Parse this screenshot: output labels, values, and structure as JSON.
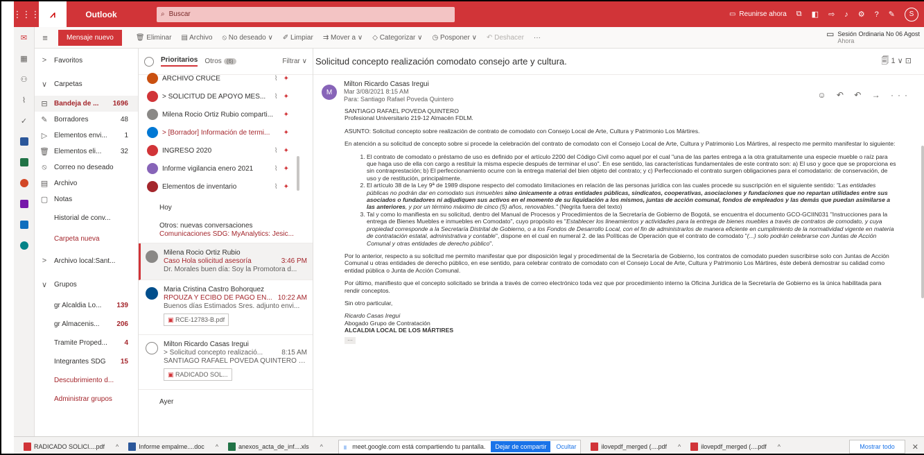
{
  "topbar": {
    "app_name": "Outlook",
    "search_placeholder": "Buscar",
    "meet_now": "Reunirse ahora",
    "avatar_initial": "S"
  },
  "command_bar": {
    "new_mail": "Mensaje nuevo",
    "delete": "Eliminar",
    "archive": "Archivo",
    "junk": "No deseado",
    "sweep": "Limpiar",
    "move_to": "Mover a",
    "categorize": "Categorizar",
    "snooze": "Posponer",
    "undo": "Deshacer",
    "more": "···",
    "meeting_title": "Sesión Ordinaria No 06 Agost",
    "meeting_time": "Ahora"
  },
  "folders": {
    "favorites": "Favoritos",
    "folders_header": "Carpetas",
    "items": [
      {
        "label": "Bandeja de ...",
        "count": "1696"
      },
      {
        "label": "Borradores",
        "count": "48"
      },
      {
        "label": "Elementos envi...",
        "count": "1"
      },
      {
        "label": "Elementos eli...",
        "count": "32"
      },
      {
        "label": "Correo no deseado",
        "count": ""
      },
      {
        "label": "Archivo",
        "count": ""
      },
      {
        "label": "Notas",
        "count": ""
      },
      {
        "label": "Historial de conv...",
        "count": ""
      },
      {
        "label": "Carpeta nueva",
        "count": ""
      }
    ],
    "local_archive": "Archivo local:Sant...",
    "groups_header": "Grupos",
    "groups": [
      {
        "label": "gr Alcaldia Lo...",
        "count": "139"
      },
      {
        "label": "gr Almacenis...",
        "count": "206"
      },
      {
        "label": "Tramite Proped...",
        "count": "4"
      },
      {
        "label": "Integrantes SDG",
        "count": "15"
      }
    ],
    "discover": "Descubrimiento d...",
    "manage_groups": "Administrar grupos"
  },
  "message_list": {
    "tab_focused": "Prioritarios",
    "tab_other": "Otros",
    "tab_other_badge": "(6)",
    "filter": "Filtrar",
    "pinned": [
      {
        "subject": "ARCHIVO CRUCE",
        "color": "#ca5010",
        "attach": true
      },
      {
        "subject": "> SOLICITUD DE APOYO MES...",
        "color": "#d13438",
        "attach": true
      },
      {
        "subject": "Milena Rocio Ortiz Rubio comparti...",
        "color": "#8a8886",
        "attach": false
      },
      {
        "subject": "> [Borrador] Información de termi...",
        "color": "#0078d4",
        "attach": false
      },
      {
        "subject": "INGRESO 2020",
        "color": "#d13438",
        "attach": true
      },
      {
        "subject": "Informe vigilancia enero 2021",
        "color": "#8764b8",
        "attach": true
      },
      {
        "subject": "Elementos de inventario",
        "color": "#a4262c",
        "attach": true
      }
    ],
    "section_today": "Hoy",
    "others_title": "Otros: nuevas conversaciones",
    "others_subtitle": "Comunicaciones SDG: MyAnalytics: Jesic...",
    "cards": [
      {
        "from": "Milena Rocio Ortiz Rubio",
        "subject": "Caso Hola solicitud asesoría",
        "time": "3:46 PM",
        "preview": "Dr. Morales buen día: Soy la Promotora d...",
        "attachment": ""
      },
      {
        "from": "Maria Cristina Castro Bohorquez",
        "subject": "RPOUZA Y ECIBO DE PAGO EN...",
        "time": "10:22 AM",
        "preview": "Buenos días Estimados Sres. adjunto envi...",
        "attachment": "RCE-12783-B.pdf"
      },
      {
        "from": "Milton Ricardo Casas Iregui",
        "subject": "> Solicitud concepto realizació...",
        "time": "8:15 AM",
        "preview": "SANTIAGO RAFAEL POVEDA QUINTERO P...",
        "attachment": "RADICADO SOL..."
      }
    ],
    "section_yesterday": "Ayer"
  },
  "reading": {
    "subject": "Solicitud concepto realización comodato consejo arte y cultura.",
    "toolbar": "1 ∨",
    "sender": "Milton Ricardo Casas Iregui",
    "avatar": "M",
    "date": "Mar 3/08/2021 8:15 AM",
    "to": "Para: Santiago Rafael Poveda Quintero",
    "actions": "☺ ↶ ↶ → ···",
    "recipient_name": "SANTIAGO RAFAEL POVEDA QUINTERO",
    "recipient_role": "Profesional Universitario 219-12 Almacén FDLM.",
    "asunto": "ASUNTO: Solicitud concepto sobre realización de contrato de comodato con Consejo Local de Arte, Cultura y Patrimonio Los Mártires.",
    "intro": "En atención a su solicitud de concepto sobre si procede la celebración del contrato de comodato con el Consejo Local de Arte, Cultura y Patrimonio Los Mártires, al respecto me permito manifestar lo siguiente:",
    "item1": "El contrato de comodato o préstamo de uso es definido por el artículo 2200 del Código Civil como aquel por el cual \"una de las partes entrega a la otra gratuitamente una especie mueble o raíz para que haga uso de ella con cargo a restituir la misma especie después de terminar el uso\". En ese sentido, las características fundamentales de este contrato son: a) El uso y goce que se proporciona es sin contraprestación; b) El perfeccionamiento ocurre con la entrega material del bien objeto del contrato; y c) Perfeccionado el contrato surgen obligaciones para el comodatario: de conservación, de uso y de restitución, principalmente.",
    "item2_a": "El artículo 38 de la Ley 9ª de 1989 dispone respecto del comodato limitaciones en relación de las personas jurídica con las cuales procede su suscripción en el siguiente sentido: ",
    "item2_b": "\"Las entidades públicas no podrán dar en comodato sus inmuebles ",
    "item2_c": "sino únicamente a otras entidades públicas, sindicatos, cooperativas, asociaciones y fundaciones que no repartan utilidades entre sus asociados o fundadores ni adjudiquen sus activos en el momento de su liquidación a los mismos, juntas de acción comunal, fondos de empleados y las demás que puedan asimilarse a las anteriores",
    "item2_d": ", y por un término máximo de cinco (5) años, renovables.\"",
    "item2_e": " (Negrita fuera del texto)",
    "item3_a": "Tal y como lo manifiesta en su solicitud, dentro del Manual de Procesos y Procedimientos de la Secretaría de Gobierno de Bogotá, se encuentra el documento GCO-GCIIN031 \"Instrucciones para la entrega de Bienes Muebles e inmuebles en Comodato\", cuyo propósito es \"",
    "item3_b": "Establecer los lineamientos y actividades para la entrega de bienes muebles a través de contratos de comodato, y cuya propiedad corresponde a la Secretaría Distrital de Gobierno, o a los Fondos de Desarrollo Local, con el fin de administrarlos de manera eficiente en cumplimiento de la normatividad vigente en materia de contratación estatal, administrativa y contable",
    "item3_c": "\", dispone en el cual en numeral 2. de las Políticas de Operación que el contrato de comodato \"",
    "item3_d": "(...) solo podrán celebrarse con Juntas de Acción Comunal y otras entidades de derecho público",
    "item3_e": "\".",
    "para1": "Por lo anterior, respecto a su solicitud me permito manifestar que por disposición legal y procedimental de la Secretaría de Gobierno, los contratos de comodato pueden suscribirse solo con Juntas de Acción Comunal u otras entidades de derecho público, en ese sentido, para celebrar contrato de comodato con el Consejo Local de Arte, Cultura y Patrimonio Los Mártires, éste deberá demostrar su calidad como entidad pública o Junta de Acción Comunal.",
    "para2": "Por último, manifiesto que el concepto solicitado se brinda a través de correo electrónico toda vez que por procedimiento interno la Oficina Jurídica de la Secretaría de Gobierno es la única habilitada para rendir conceptos.",
    "closing": "Sin otro particular,",
    "sig_name": "Ricardo Casas Iregui",
    "sig_role": "Abogado Grupo de Contratación",
    "sig_org": "ALCALDIA LOCAL DE LOS MÁRTIRES",
    "more": "···"
  },
  "download_bar": {
    "items": [
      {
        "name": "RADICADO SOLICI....pdf",
        "color": "#d13438"
      },
      {
        "name": "Informe empalme....doc",
        "color": "#2b579a"
      },
      {
        "name": "anexos_acta_de_inf....xls",
        "color": "#217346"
      }
    ],
    "share_text": "meet.google.com está compartiendo tu pantalla.",
    "stop_share": "Dejar de compartir",
    "hide": "Ocultar",
    "items2": [
      {
        "name": "ilovepdf_merged (....pdf",
        "color": "#d13438"
      },
      {
        "name": "ilovepdf_merged (....pdf",
        "color": "#d13438"
      }
    ],
    "show_all": "Mostrar todo",
    "close": "✕"
  }
}
